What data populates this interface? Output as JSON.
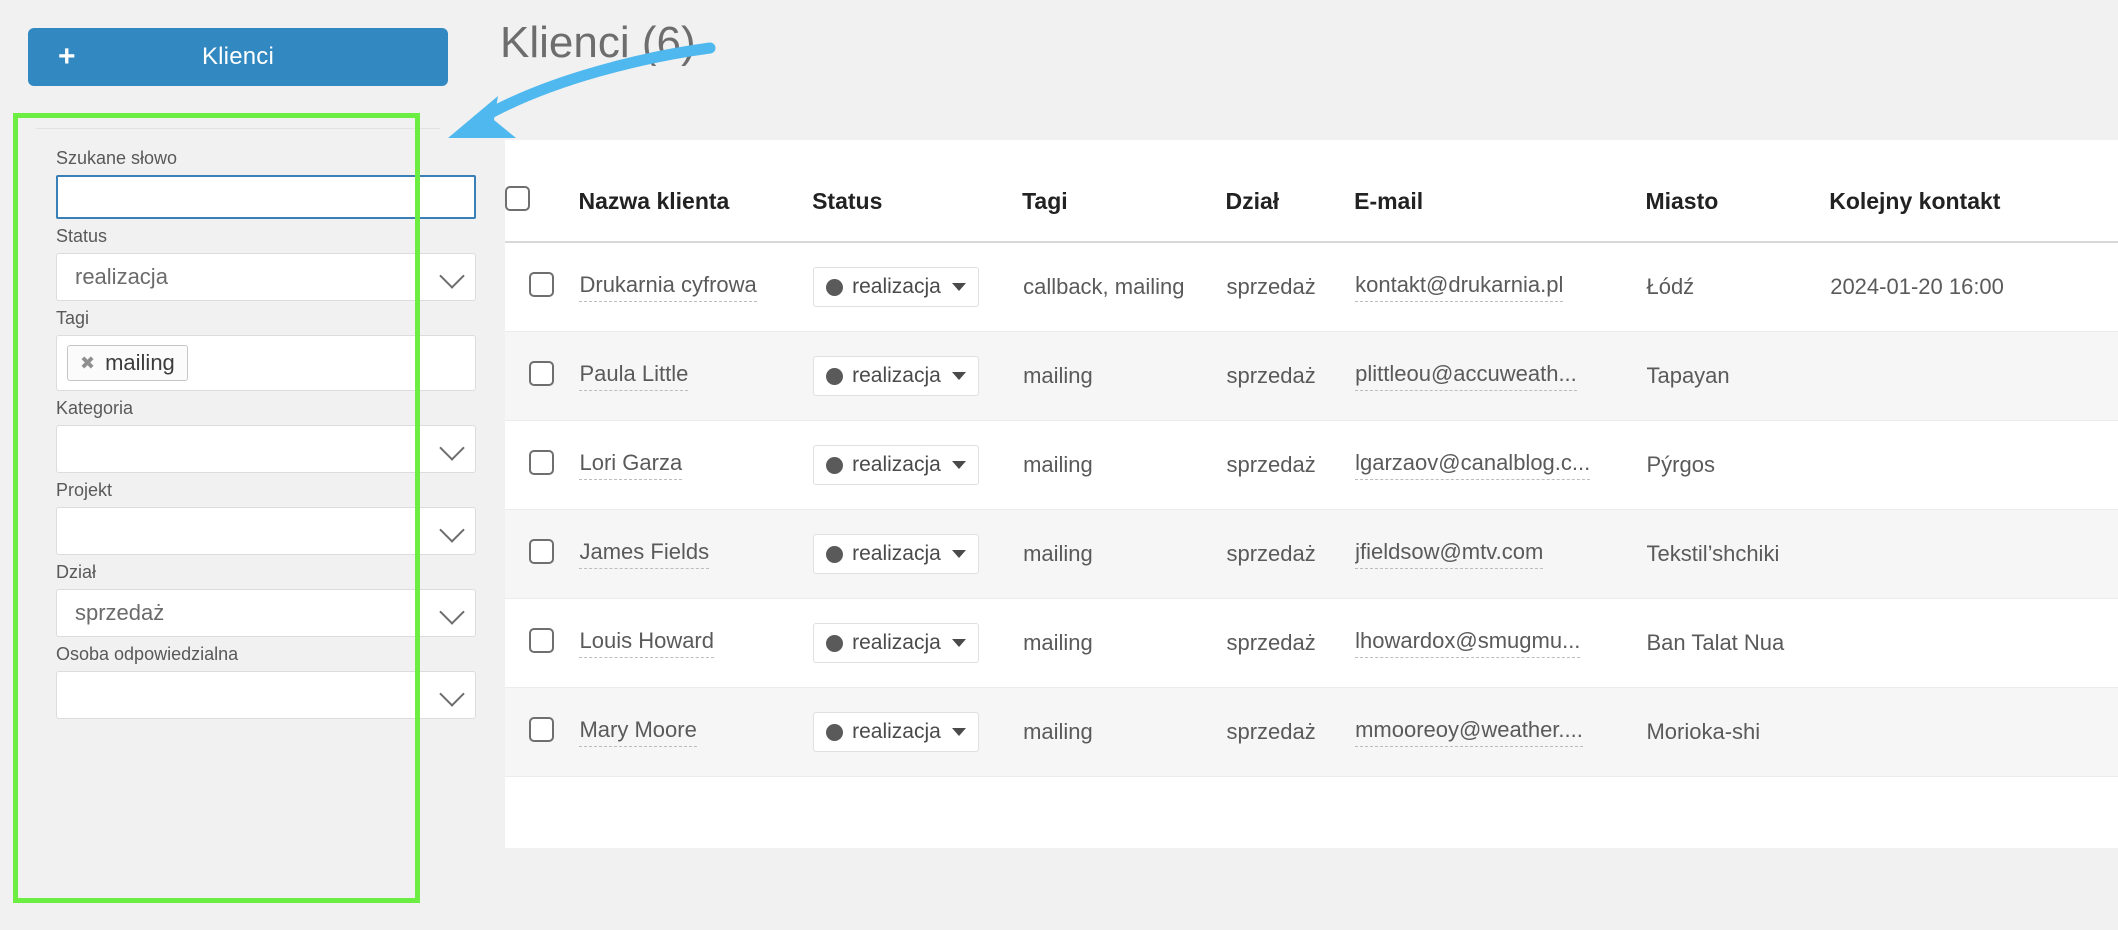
{
  "sidebar": {
    "add_button": {
      "label": "Klienci",
      "icon": "plus-icon"
    },
    "fields": [
      {
        "label": "Szukane słowo",
        "type": "text",
        "value": "",
        "placeholder": ""
      },
      {
        "label": "Status",
        "type": "select",
        "value": "realizacja"
      },
      {
        "label": "Tagi",
        "type": "tags",
        "tags": [
          "mailing"
        ]
      },
      {
        "label": "Kategoria",
        "type": "select",
        "value": ""
      },
      {
        "label": "Projekt",
        "type": "select",
        "value": ""
      },
      {
        "label": "Dział",
        "type": "select",
        "value": "sprzedaż"
      },
      {
        "label": "Osoba odpowiedzialna",
        "type": "select",
        "value": ""
      }
    ]
  },
  "main": {
    "title": "Klienci (6)",
    "table": {
      "columns": [
        "",
        "Nazwa klienta",
        "Status",
        "Tagi",
        "Dział",
        "E-mail",
        "Miasto",
        "Kolejny kontakt"
      ],
      "rows": [
        {
          "name": "Drukarnia cyfrowa",
          "status": "realizacja",
          "tags": "callback, mailing",
          "dept": "sprzedaż",
          "email": "kontakt@drukarnia.pl",
          "city": "Łódź",
          "next_contact": "2024-01-20 16:00"
        },
        {
          "name": "Paula Little",
          "status": "realizacja",
          "tags": "mailing",
          "dept": "sprzedaż",
          "email": "plittleou@accuweath...",
          "city": "Tapayan",
          "next_contact": ""
        },
        {
          "name": "Lori Garza",
          "status": "realizacja",
          "tags": "mailing",
          "dept": "sprzedaż",
          "email": "lgarzaov@canalblog.c...",
          "city": "Pýrgos",
          "next_contact": ""
        },
        {
          "name": "James Fields",
          "status": "realizacja",
          "tags": "mailing",
          "dept": "sprzedaż",
          "email": "jfieldsow@mtv.com",
          "city": "Tekstil’shchiki",
          "next_contact": ""
        },
        {
          "name": "Louis Howard",
          "status": "realizacja",
          "tags": "mailing",
          "dept": "sprzedaż",
          "email": "lhowardox@smugmu...",
          "city": "Ban Talat Nua",
          "next_contact": ""
        },
        {
          "name": "Mary Moore",
          "status": "realizacja",
          "tags": "mailing",
          "dept": "sprzedaż",
          "email": "mmooreoy@weather....",
          "city": "Morioka-shi",
          "next_contact": ""
        }
      ]
    }
  },
  "annotations": {
    "highlight_color": "#6ced42",
    "arrow_color": "#4fb8ee",
    "accent_color": "#3288c0"
  }
}
